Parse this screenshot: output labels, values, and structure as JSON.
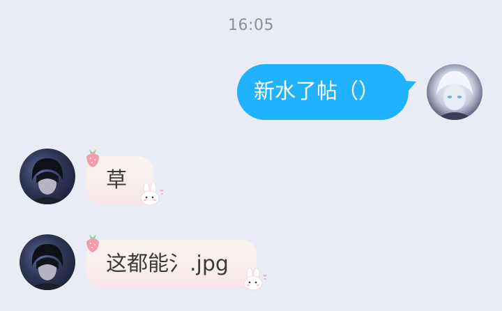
{
  "chat": {
    "timestamp": "16:05",
    "messages": [
      {
        "side": "out",
        "text": "新水了帖（）"
      },
      {
        "side": "in",
        "text": "草"
      },
      {
        "side": "in",
        "text": "这都能氵.jpg"
      }
    ]
  },
  "colors": {
    "background": "#e9ecf5",
    "outgoing_bubble": "#21b2fd",
    "incoming_bubble": "#f8efec"
  },
  "icons": [
    "strawberry-sticker-icon",
    "bunny-sticker-icon"
  ]
}
